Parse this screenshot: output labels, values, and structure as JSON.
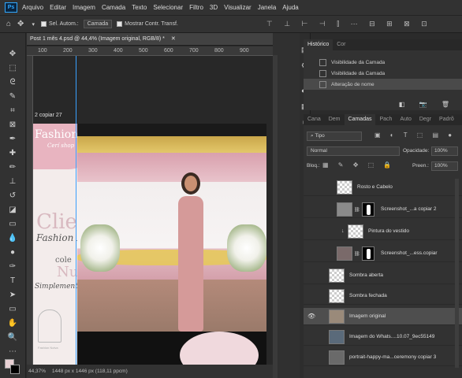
{
  "menu": {
    "logo": "Ps",
    "items": [
      "Arquivo",
      "Editar",
      "Imagem",
      "Camada",
      "Texto",
      "Selecionar",
      "Filtro",
      "3D",
      "Visualizar",
      "Janela",
      "Ajuda"
    ]
  },
  "options": {
    "auto_select_label": "Sel. Autom.:",
    "auto_select_value": "Camada",
    "transform_label": "Mostrar Contr. Transf."
  },
  "document": {
    "tab_title": "Post 1 mês 4.psd @ 44,4% (Imagem original, RGB/8) *",
    "ruler_ticks": [
      "100",
      "200",
      "300",
      "400",
      "500",
      "600",
      "700",
      "800",
      "900"
    ],
    "layer_label": "2 copiar 27",
    "zoom": "44,37%",
    "doc_info": "1448 px x 1446 px (118,11 ppcm)"
  },
  "artwork": {
    "brand_title": "Fashion",
    "brand_script": "Cerí shop",
    "big_text": "Clie",
    "fashion_text": "Fashion N",
    "cole_text": "cole",
    "nu_text": "Nu",
    "simple_text": "Simplement",
    "footer_text": "Fashion Noiva"
  },
  "history": {
    "tabs": [
      "Histórico",
      "Cor"
    ],
    "items": [
      "Visibilidade da Camada",
      "Visibilidade da Camada",
      "Alteração de nome"
    ],
    "selected_index": 2
  },
  "layers_panel": {
    "tabs": [
      "Cana",
      "Dem",
      "Camadas",
      "Pach",
      "Auto",
      "Degr",
      "Padrõ"
    ],
    "active_tab": "Camadas",
    "filter_label": "Tipo",
    "blend_mode": "Normal",
    "opacity_label": "Opacidade:",
    "opacity_value": "100%",
    "lock_label": "Bloq.:",
    "fill_label": "Preen.:",
    "fill_value": "100%",
    "layers": [
      {
        "name": "Rosto e Cabelo",
        "visible": false,
        "mask": false,
        "selected": false
      },
      {
        "name": "Screenshot_...a copiar 2",
        "visible": false,
        "mask": true,
        "selected": false
      },
      {
        "name": "Pintura do vestido",
        "visible": false,
        "mask": false,
        "selected": false
      },
      {
        "name": "Screenshot_...ess.copiar",
        "visible": false,
        "mask": true,
        "selected": false
      },
      {
        "name": "Sombra aberta",
        "visible": false,
        "mask": false,
        "selected": false
      },
      {
        "name": "Sombra fechada",
        "visible": false,
        "mask": false,
        "selected": false
      },
      {
        "name": "Imagem original",
        "visible": true,
        "mask": false,
        "selected": true
      },
      {
        "name": "Imagem do Whats....10.07_9ec55149",
        "visible": false,
        "mask": false,
        "selected": false
      },
      {
        "name": "portrait-happy-ma...ceremony copiar 3",
        "visible": false,
        "mask": false,
        "selected": false
      }
    ]
  },
  "colors": {
    "accent": "#31a8ff",
    "brand_pink": "#e8b4c0",
    "panel_bg": "#323232"
  }
}
